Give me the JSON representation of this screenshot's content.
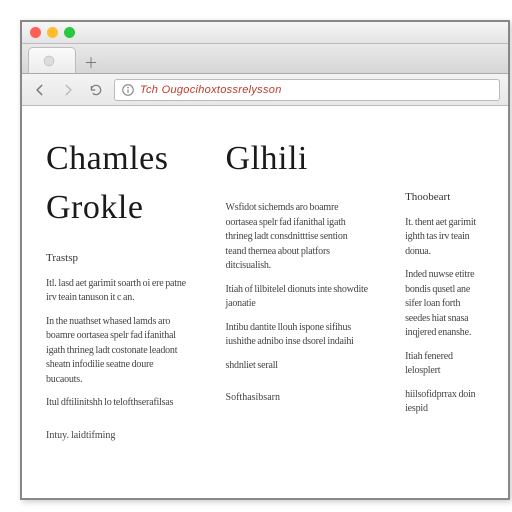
{
  "window": {
    "traffic_colors": {
      "close": "#ff5f57",
      "min": "#febc2e",
      "max": "#28c840"
    }
  },
  "tabs": [
    {
      "label": ""
    }
  ],
  "address": {
    "url_display": "Tch Ougocihoxtossrelysson"
  },
  "content": {
    "heading_left": "Chamles Grokle",
    "heading_right": "Glhili",
    "left": {
      "lead": "Trastsp",
      "p1": "Itl. lasd aet garimit soarth oi ere patne irv teain tanuson it c an.",
      "p2": "In the nuathset whased lamds aro boamre oortasea spelr fad ifanithal igath thrineg ladt costonate leadont sheatn infodilie seatne doure bucaouts.",
      "p3": "Itul dftilinitshh lo telofthserafilsas",
      "footer": "Intuy.  laidtifming"
    },
    "mid": {
      "p1": "Wsfidot sichemds aro boamre oortasea spelr fad ifanithal igath thrineg ladt consdnitttise sention teand thernea about platfors ditcisualish.",
      "p2": "Itiah of lilbitelel dionuts inte showdite jaonatie",
      "p3": "Intibu dantite llouh ispone sifihus iushithe adnibo inse dsorel indaihi",
      "p4": "shdnliet serall",
      "footer": "Softhasibsarn"
    },
    "right": {
      "lead": "Thoobeart",
      "p1": "It. thent aet garimit ighth tas irv teain donua.",
      "p2": "Inded nuwse etitre bondis qusetl ane sifer loan forth seedes hiat snasa inqjered enanshe.",
      "p3": "Itiah fenered lelosplert",
      "p4": "hiilsofidprrax doin iespid"
    }
  }
}
